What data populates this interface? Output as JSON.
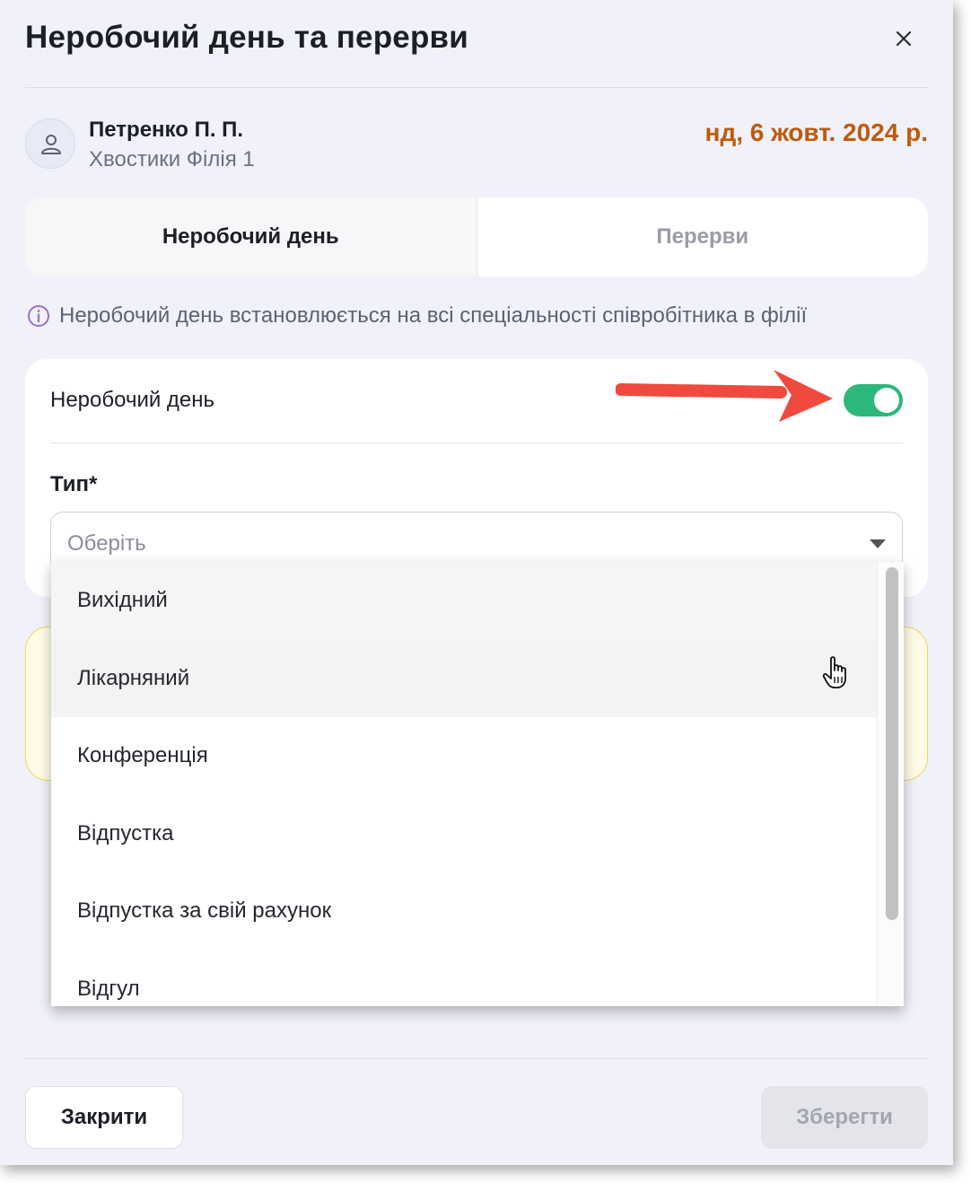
{
  "modal": {
    "title": "Неробочий день та перерви"
  },
  "employee": {
    "name": "Петренко П. П.",
    "branch": "Хвостики Філія 1",
    "date": "нд, 6 жовт. 2024 р."
  },
  "tabs": [
    {
      "label": "Неробочий день",
      "active": true
    },
    {
      "label": "Перерви",
      "active": false
    }
  ],
  "info_text": "Неробочий день встановлюється на всі спеціальності співробітника в філії",
  "form": {
    "switch_label": "Неробочий день",
    "switch_on": true,
    "type_label": "Тип",
    "required_mark": "*",
    "select_placeholder": "Оберіть"
  },
  "dropdown": {
    "options": [
      "Вихідний",
      "Лікарняний",
      "Конференція",
      "Відпустка",
      "Відпустка за свій рахунок",
      "Відгул"
    ]
  },
  "footer": {
    "close_label": "Закрити",
    "save_label": "Зберегти"
  },
  "colors": {
    "accent_date": "#c05a0c",
    "toggle_on": "#2db77a",
    "annotation_arrow": "#f04a3e"
  }
}
